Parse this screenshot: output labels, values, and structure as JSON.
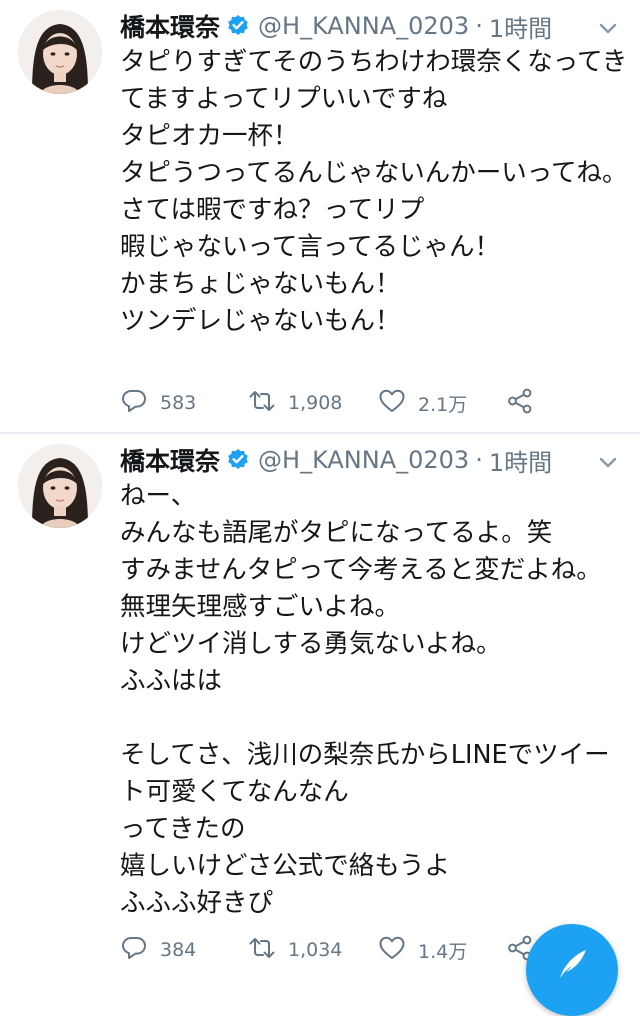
{
  "tweets": [
    {
      "author": {
        "name": "橋本環奈",
        "handle": "@H_KANNA_0203",
        "verified": true
      },
      "separator": "·",
      "time": "1時間",
      "text": "タピりすぎてそのうちわけわ環奈くなってきてますよってリプいいですね\nタピオカ一杯！\nタピうつってるんじゃないんかーいってね。\nさては暇ですね？ってリプ\n暇じゃないって言ってるじゃん！\nかまちょじゃないもん！\nツンデレじゃないもん！",
      "replies": "583",
      "retweets": "1,908",
      "likes": "2.1万"
    },
    {
      "author": {
        "name": "橋本環奈",
        "handle": "@H_KANNA_0203",
        "verified": true
      },
      "separator": "·",
      "time": "1時間",
      "text": "ねー、\nみんなも語尾がタピになってるよ。笑\nすみませんタピって今考えると変だよね。\n無理矢理感すごいよね。\nけどツイ消しする勇気ないよね。\nふふはは\n\nそしてさ、浅川の梨奈氏からLINEでツイート可愛くてなんなん\nってきたの\n嬉しいけどさ公式で絡もうよ\nふふふ好きぴ",
      "replies": "384",
      "retweets": "1,034",
      "likes": "1.4万"
    }
  ],
  "icons": {
    "verified": "verified-badge-icon",
    "caret": "chevron-down-icon",
    "reply": "reply-icon",
    "retweet": "retweet-icon",
    "like": "heart-icon",
    "share": "share-icon",
    "compose": "compose-feather-icon"
  },
  "colors": {
    "accent": "#1da1f2",
    "text": "#14171a",
    "muted": "#657786",
    "divider": "#e6ecf0"
  }
}
